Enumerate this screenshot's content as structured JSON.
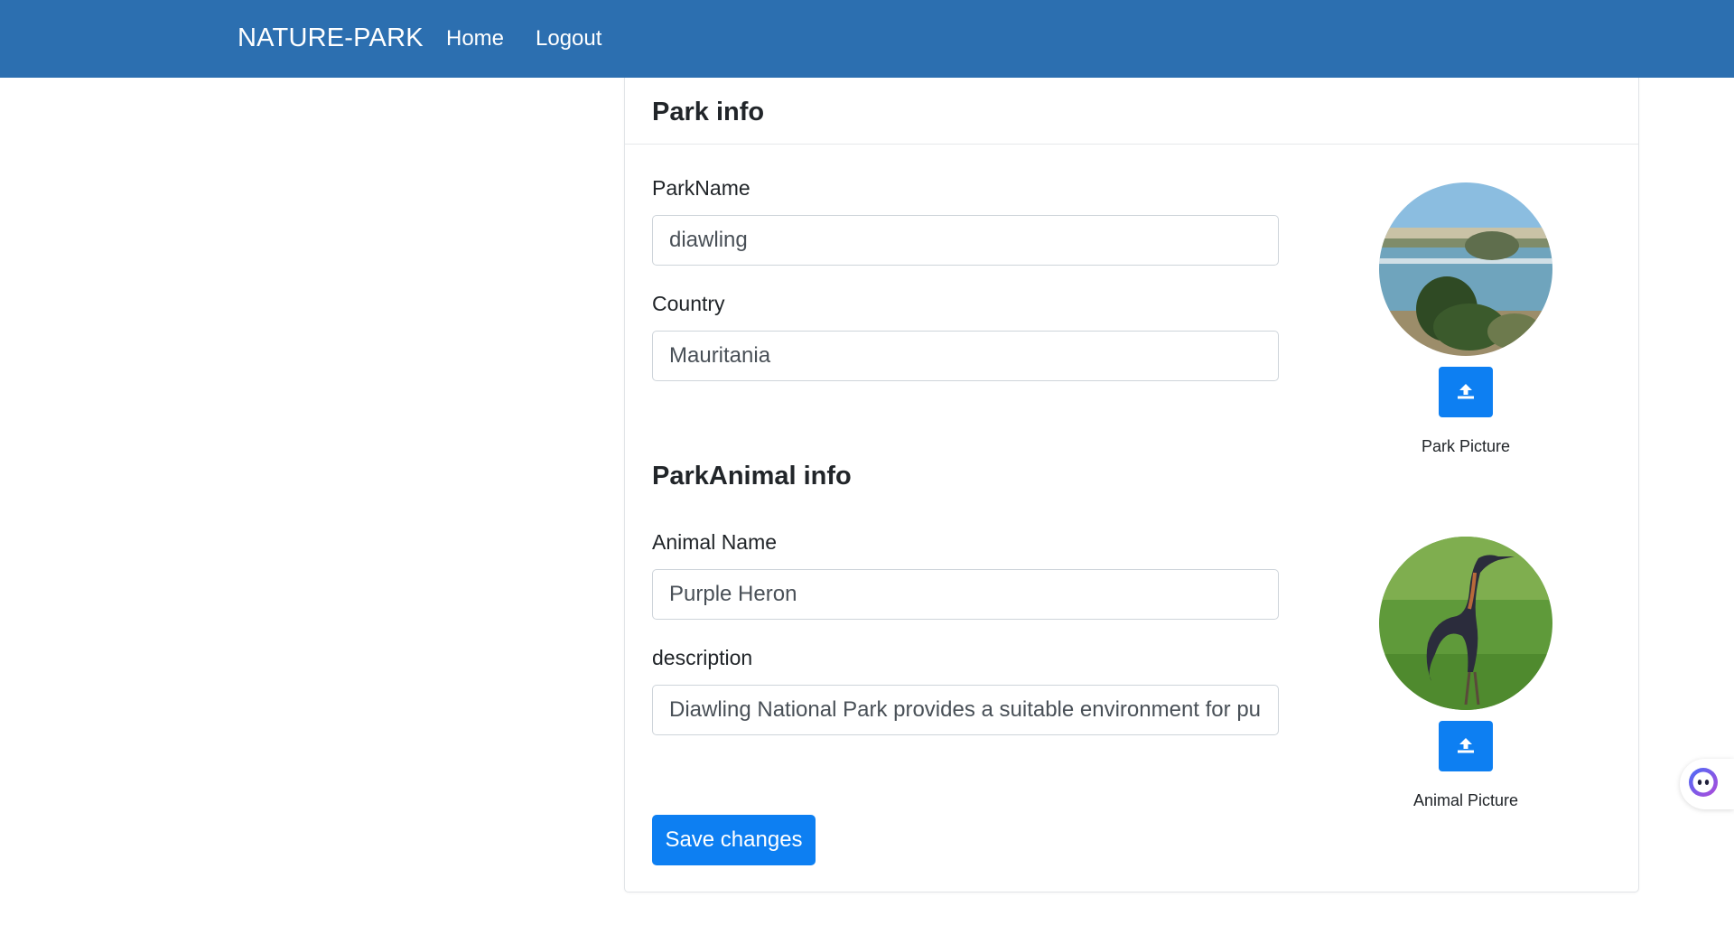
{
  "navbar": {
    "brand": "NATURE-PARK",
    "links": [
      "Home",
      "Logout"
    ],
    "background": "#2c6fb0"
  },
  "park": {
    "title": "Park info",
    "name_label": "ParkName",
    "name_value": "diawling",
    "country_label": "Country",
    "country_value": "Mauritania",
    "picture_caption": "Park Picture"
  },
  "animal": {
    "title": "ParkAnimal info",
    "name_label": "Animal Name",
    "name_value": "Purple Heron",
    "description_label": "description",
    "description_value": "Diawling National Park provides a suitable environment for pu",
    "picture_caption": "Animal Picture"
  },
  "actions": {
    "save_label": "Save changes"
  },
  "icons": {
    "upload": "upload-icon",
    "assistant": "assistant-icon"
  },
  "colors": {
    "primary": "#0d7ff2",
    "navbar": "#2c6fb0"
  }
}
